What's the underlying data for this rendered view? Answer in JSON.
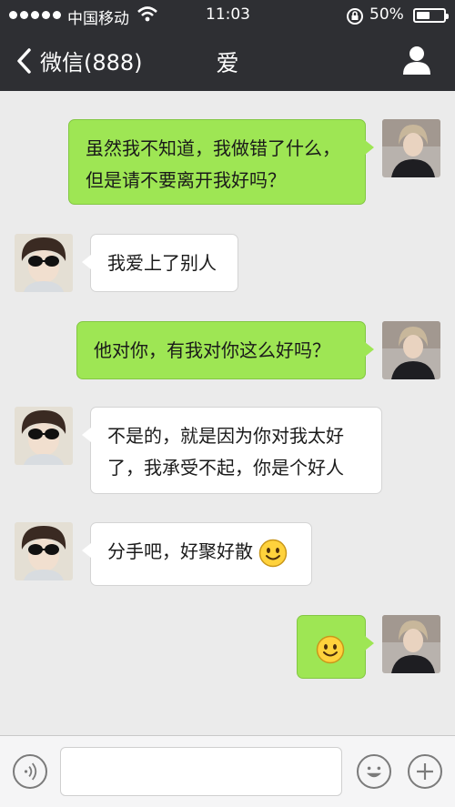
{
  "status_bar": {
    "carrier": "中国移动",
    "time": "11:03",
    "battery_percent": "50%",
    "battery_level": 0.5,
    "signal_dots": 5
  },
  "nav": {
    "back_label": "微信(888)",
    "title": "爱"
  },
  "messages": [
    {
      "direction": "out",
      "text": "虽然我不知道，我做错了什么，但是请不要离开我好吗？"
    },
    {
      "direction": "in",
      "text": "我爱上了别人"
    },
    {
      "direction": "out",
      "text": "他对你，有我对你这么好吗？"
    },
    {
      "direction": "in",
      "text": "不是的，就是因为你对我太好了，我承受不起，你是个好人"
    },
    {
      "direction": "in",
      "text": "分手吧，好聚好散",
      "emoji": "smile-emoji"
    },
    {
      "direction": "out",
      "text": "",
      "emoji": "smile-emoji"
    }
  ],
  "colors": {
    "header_bg": "#2e2f33",
    "chat_bg": "#ebebeb",
    "outgoing_bubble": "#9ee654",
    "incoming_bubble": "#ffffff"
  },
  "icons": {
    "voice": "voice-icon",
    "emoji": "emoji-icon",
    "more": "plus-icon",
    "profile": "person-icon",
    "back": "chevron-left-icon"
  }
}
